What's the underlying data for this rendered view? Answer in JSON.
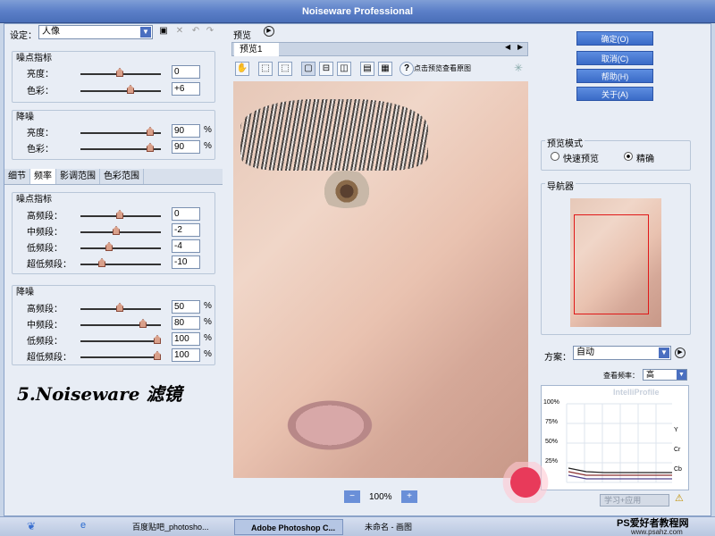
{
  "window": {
    "title": "Noiseware Professional"
  },
  "settings": {
    "label": "设定：",
    "preset": "人像"
  },
  "top_group": {
    "title": "噪点指标",
    "rows": [
      {
        "label": "亮度：",
        "value": "0"
      },
      {
        "label": "色彩：",
        "value": "+6"
      }
    ]
  },
  "noise_group": {
    "title": "降噪",
    "rows": [
      {
        "label": "亮度：",
        "value": "90",
        "unit": "%"
      },
      {
        "label": "色彩：",
        "value": "90",
        "unit": "%"
      }
    ]
  },
  "tabs": [
    "细节",
    "频率",
    "影调范围",
    "色彩范围"
  ],
  "freq_group": {
    "title": "噪点指标",
    "rows": [
      {
        "label": "高频段：",
        "value": "0"
      },
      {
        "label": "中频段：",
        "value": "-2"
      },
      {
        "label": "低频段：",
        "value": "-4"
      },
      {
        "label": "超低频段：",
        "value": "-10"
      }
    ]
  },
  "freq_noise_group": {
    "title": "降噪",
    "rows": [
      {
        "label": "高频段：",
        "value": "50",
        "unit": "%"
      },
      {
        "label": "中频段：",
        "value": "80",
        "unit": "%"
      },
      {
        "label": "低频段：",
        "value": "100",
        "unit": "%"
      },
      {
        "label": "超低频段：",
        "value": "100",
        "unit": "%"
      }
    ]
  },
  "caption": "5.Noiseware 滤镜",
  "preview": {
    "label": "预览",
    "tab": "预览1",
    "hint": "点击预览查看原图",
    "zoom": "100%"
  },
  "buttons": {
    "ok": "确定(O)",
    "cancel": "取消(C)",
    "help": "帮助(H)",
    "about": "关于(A)"
  },
  "preview_mode": {
    "title": "预览模式",
    "fast": "快速预览",
    "accurate": "精确",
    "selected": "精确"
  },
  "navigator": {
    "title": "导航器"
  },
  "scheme": {
    "label": "方案：",
    "value": "自动",
    "freq_label": "查看频率：",
    "freq_value": "高",
    "chart_brand": "IntelliProfile",
    "apply": "学习+应用"
  },
  "chart_data": {
    "type": "line",
    "y_ticks": [
      "100%",
      "75%",
      "50%",
      "25%"
    ],
    "legend": [
      "Y",
      "Cr",
      "Cb"
    ]
  },
  "taskbar": {
    "items": [
      "百度贴吧_photosho...",
      "Adobe Photoshop C...",
      "未命名 - 画图"
    ],
    "watermark": "PS爱好者教程网",
    "watermark_url": "www.psahz.com"
  }
}
